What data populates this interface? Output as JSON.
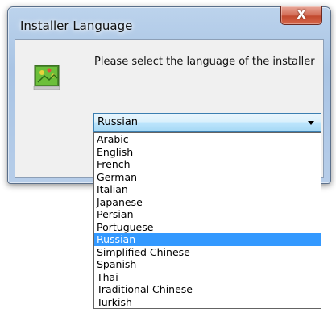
{
  "window": {
    "title": "Installer Language",
    "close_glyph": "X",
    "prompt": "Please select the language of the installer"
  },
  "language_select": {
    "selected": "Russian",
    "options": [
      "Arabic",
      "English",
      "French",
      "German",
      "Italian",
      "Japanese",
      "Persian",
      "Portuguese",
      "Russian",
      "Simplified Chinese",
      "Spanish",
      "Thai",
      "Traditional Chinese",
      "Turkish"
    ],
    "highlighted_index": 8
  },
  "colors": {
    "highlight": "#3399ff",
    "close_button": "#c24a2f",
    "title_bar": "#b6cde9"
  },
  "icons": {
    "app": "installer-app-icon",
    "close": "close-icon",
    "dropdown": "chevron-down-icon"
  }
}
